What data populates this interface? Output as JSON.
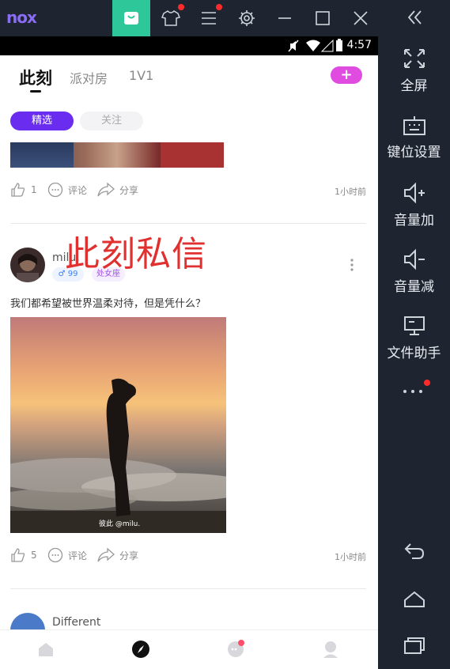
{
  "emulator": {
    "logo": "nox",
    "toolbar_icons": [
      "shopping-bag-icon",
      "shirt-icon",
      "menu-icon",
      "settings-icon",
      "minimize-icon",
      "maximize-icon",
      "close-icon"
    ],
    "side_items": [
      {
        "label": "全屏",
        "icon": "fullscreen-icon"
      },
      {
        "label": "键位设置",
        "icon": "keyboard-icon"
      },
      {
        "label": "音量加",
        "icon": "volume-up-icon"
      },
      {
        "label": "音量减",
        "icon": "volume-down-icon"
      },
      {
        "label": "文件助手",
        "icon": "monitor-icon"
      }
    ],
    "colors": {
      "bar": "#1e2430",
      "active": "#2ec79a",
      "badge": "#ff2b2b"
    }
  },
  "statusbar": {
    "time": "4:57"
  },
  "app": {
    "tabs": [
      {
        "label": "此刻"
      },
      {
        "label": "派对房"
      },
      {
        "label": "1V1"
      }
    ],
    "add_label": "+",
    "chips": [
      {
        "label": "精选"
      },
      {
        "label": "关注"
      }
    ],
    "post1": {
      "likes": "1",
      "comment": "评论",
      "share": "分享",
      "time_ago": "1小时前"
    },
    "overlay_text": "此刻私信",
    "post2": {
      "username": "milu.",
      "gender_badge": "♂ 99",
      "zodiac_badge": "处女座",
      "text": "我们都希望被世界温柔对待，但是凭什么？",
      "photo_credit": "彼此 @milu.",
      "likes": "5",
      "comment": "评论",
      "share": "分享",
      "time_ago": "1小时前"
    },
    "post3": {
      "username": "Different"
    },
    "colors": {
      "accent": "#6a2df0",
      "pink": "#e04be0"
    }
  }
}
